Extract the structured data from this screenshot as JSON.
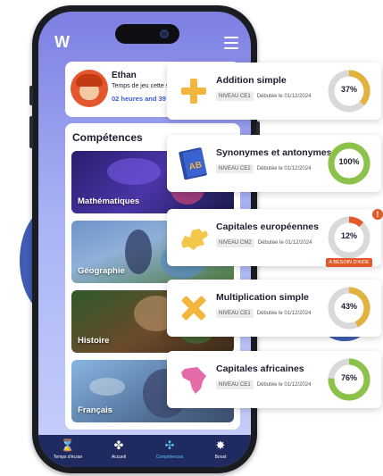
{
  "app": {
    "logo_label": "W"
  },
  "profile": {
    "name": "Ethan",
    "week_text": "Temps de jeu cette se",
    "time_text": "02 heures and 39 mi"
  },
  "skills": {
    "title": "Compétences",
    "items": [
      {
        "label": "Mathématiques"
      },
      {
        "label": "Géographie"
      },
      {
        "label": "Histoire"
      },
      {
        "label": "Français"
      }
    ]
  },
  "tabbar": {
    "items": [
      {
        "label": "Temps d'écran",
        "icon": "hourglass-icon"
      },
      {
        "label": "Accueil",
        "icon": "home-grid-icon"
      },
      {
        "label": "Compétences",
        "icon": "puzzle-icon"
      },
      {
        "label": "Boost",
        "icon": "burst-icon"
      }
    ]
  },
  "cards": [
    {
      "title": "Addition simple",
      "level": "NIVEAU CE1",
      "started": "Débutée le 01/12/2024",
      "progress": 37,
      "progress_label": "37%",
      "ring_color": "#e2b23f",
      "icon": "plus-icon"
    },
    {
      "title": "Synonymes et antonymes",
      "level": "NIVEAU CE2",
      "started": "Débutée le 01/12/2024",
      "progress": 100,
      "progress_label": "100%",
      "ring_color": "#8bc34a",
      "icon": "book-icon"
    },
    {
      "title": "Capitales européennes",
      "level": "NIVEAU CM2",
      "started": "Débutée le 01/12/2024",
      "progress": 12,
      "progress_label": "12%",
      "ring_color": "#e25a2a",
      "icon": "europe-map-icon",
      "help_label": "A BESOIN D'AIDE"
    },
    {
      "title": "Multiplication simple",
      "level": "NIVEAU CE1",
      "started": "Débutée le 01/12/2024",
      "progress": 43,
      "progress_label": "43%",
      "ring_color": "#e2b23f",
      "icon": "times-icon"
    },
    {
      "title": "Capitales africaines",
      "level": "NIVEAU CE1",
      "started": "Débutée le 01/12/2024",
      "progress": 76,
      "progress_label": "76%",
      "ring_color": "#8bc34a",
      "icon": "africa-map-icon"
    }
  ],
  "colors": {
    "accent": "#3b5bdb",
    "tabbar": "#1f2a60",
    "ring_track": "#d9d9d9"
  }
}
